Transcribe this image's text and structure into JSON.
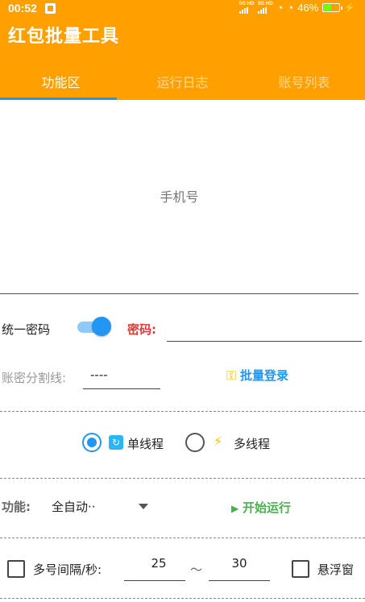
{
  "status_bar": {
    "time": "00:52",
    "network_1": "5G HD",
    "network_2": "5G HD",
    "battery": "46%"
  },
  "app": {
    "title": "红包批量工具"
  },
  "tabs": [
    {
      "label": "功能区",
      "active": true
    },
    {
      "label": "运行日志",
      "active": false
    },
    {
      "label": "账号列表",
      "active": false
    }
  ],
  "phone_input": {
    "placeholder": "手机号",
    "value": ""
  },
  "password_row": {
    "unified_label": "统一密码",
    "unified_enabled": true,
    "password_label": "密码:",
    "password_value": ""
  },
  "separator_row": {
    "label": "账密分割线:",
    "value": "----",
    "batch_login": "批量登录"
  },
  "thread_mode": {
    "single": "单线程",
    "multi": "多线程",
    "selected": "single"
  },
  "function_row": {
    "label": "功能:",
    "selected": "全自动··",
    "start": "开始运行"
  },
  "interval_row": {
    "label": "多号间隔/秒:",
    "checked": false,
    "min": "25",
    "tilde": "～",
    "max": "30",
    "float_label": "悬浮窗",
    "float_checked": false
  },
  "colors": {
    "app_bar": "#FFA000",
    "accent": "#2196F3",
    "password_label": "#E53935",
    "start": "#4CAF50"
  },
  "icons": {
    "sync": "sync-icon",
    "bolt": "lightning-icon",
    "key": "key-icon",
    "play": "play-icon"
  }
}
